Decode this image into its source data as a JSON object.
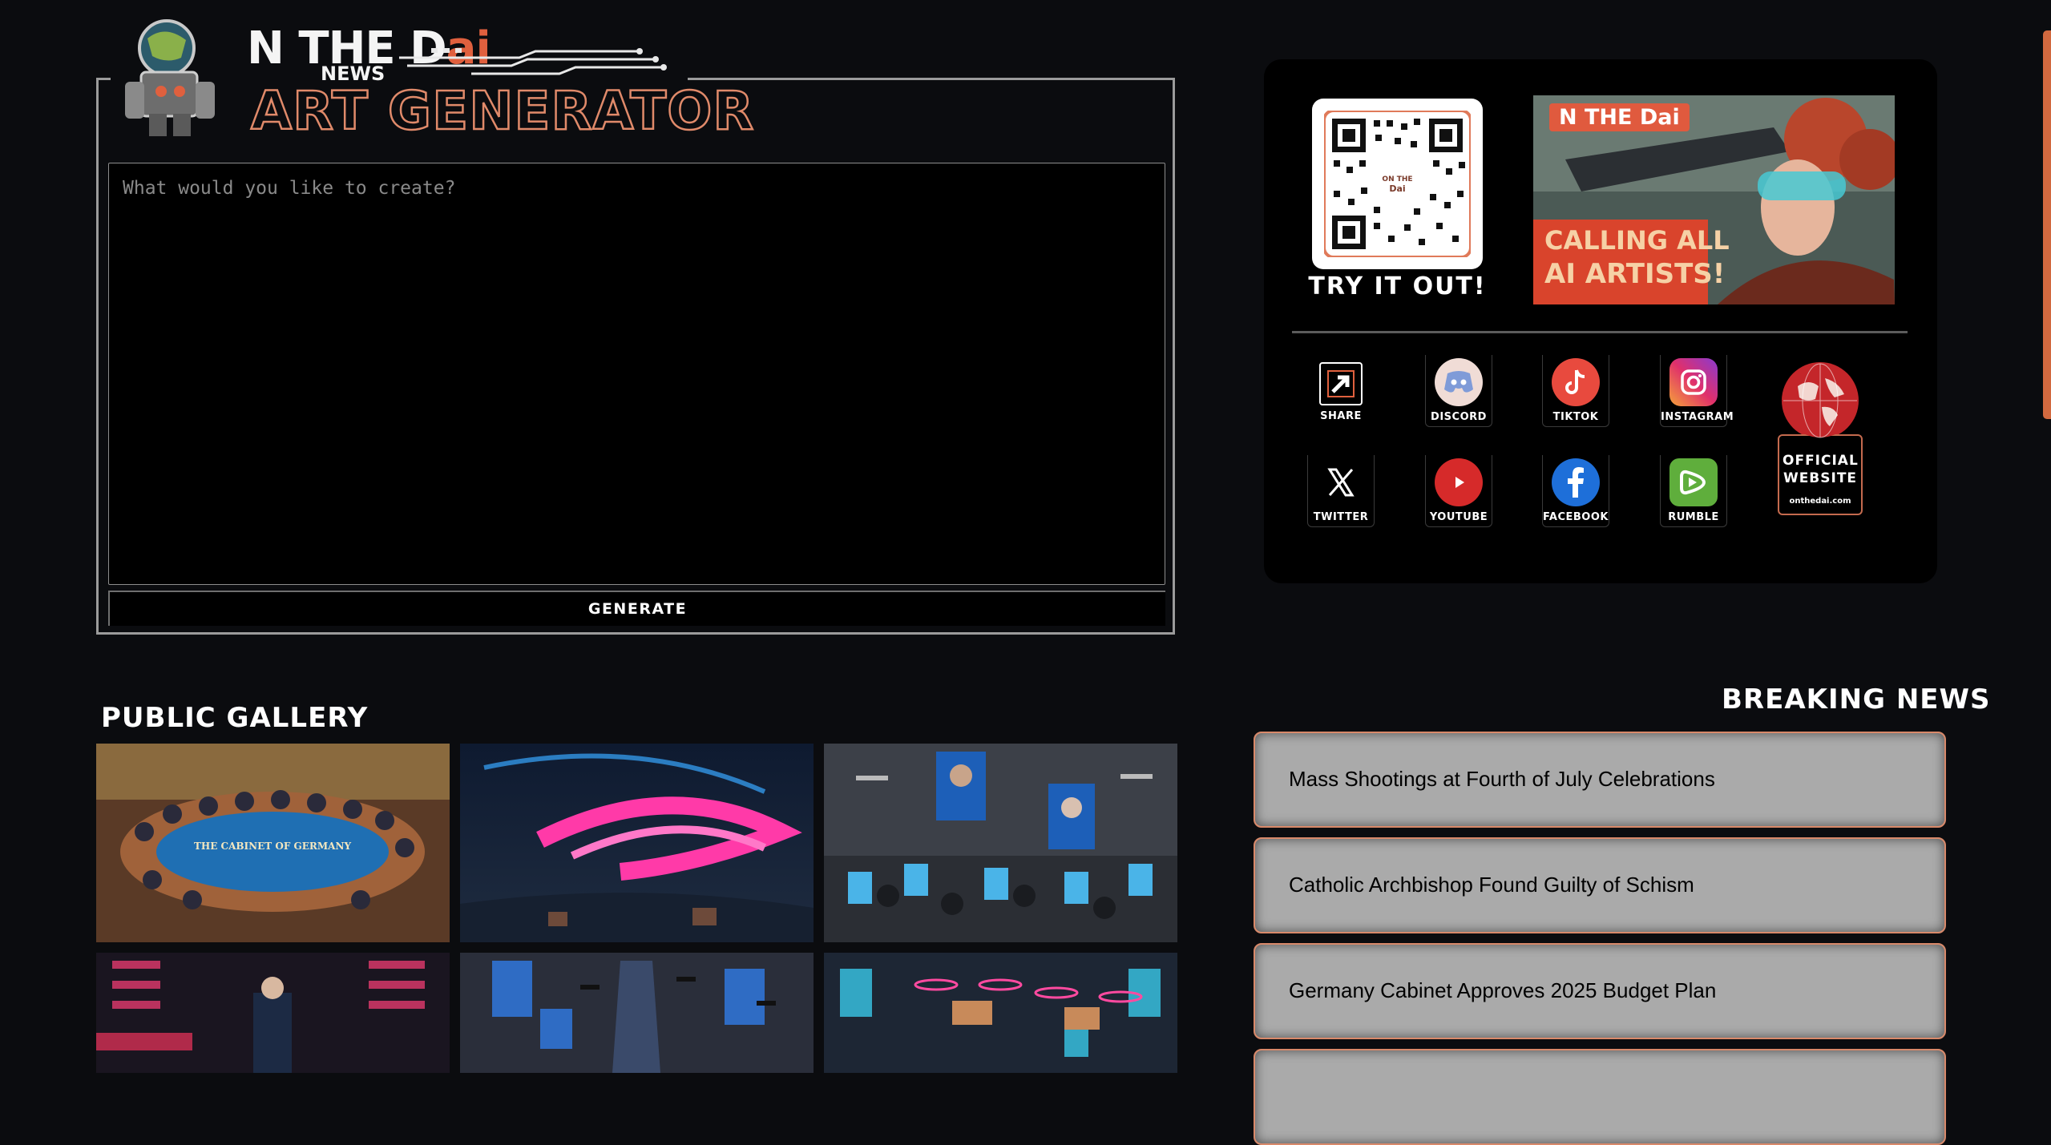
{
  "logo": {
    "brand_prefix": "N THE D",
    "brand_suffix": "ai",
    "news": "NEWS",
    "tagline": "ART GENERATOR"
  },
  "generator": {
    "placeholder": "What would you like to create?",
    "value": "",
    "generate_label": "GENERATE"
  },
  "promo": {
    "qr_center_text": "ON THE Dai",
    "try_label": "TRY IT OUT!",
    "ad_logo": "N THE Dai",
    "ad_line1": "CALLING ALL",
    "ad_line2": "AI ARTISTS!"
  },
  "socials": {
    "share": "SHARE",
    "discord": "DISCORD",
    "tiktok": "TIKTOK",
    "instagram": "INSTAGRAM",
    "twitter": "TWITTER",
    "youtube": "YOUTUBE",
    "facebook": "FACEBOOK",
    "rumble": "RUMBLE",
    "official_label": "OFFICIAL WEBSITE",
    "official_url": "onthedai.com"
  },
  "gallery": {
    "title": "PUBLIC GALLERY",
    "tile1_caption": "THE CABINET OF GERMANY"
  },
  "news": {
    "title": "BREAKING NEWS",
    "items": [
      "Mass Shootings at Fourth of July Celebrations",
      "Catholic Archbishop Found Guilty of Schism",
      "Germany Cabinet Approves 2025 Budget Plan"
    ]
  },
  "colors": {
    "background": "#0b0c0f",
    "accent": "#e0603e",
    "card": "#aaaaaa"
  }
}
